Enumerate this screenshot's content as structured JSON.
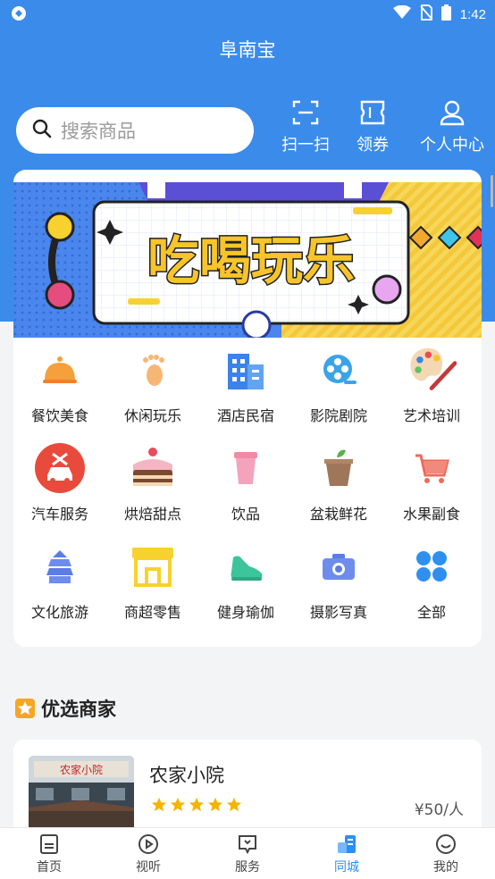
{
  "status_bar": {
    "time": "1:42"
  },
  "app": {
    "title": "阜南宝"
  },
  "search": {
    "placeholder": "搜索商品"
  },
  "quick_actions": [
    {
      "label": "扫一扫",
      "icon": "scan-icon"
    },
    {
      "label": "领券",
      "icon": "coupon-icon"
    },
    {
      "label": "个人中心",
      "icon": "user-icon"
    }
  ],
  "banner": {
    "text": "吃喝玩乐"
  },
  "categories": [
    {
      "label": "餐饮美食",
      "icon": "food-cover-icon"
    },
    {
      "label": "休闲玩乐",
      "icon": "footprint-icon"
    },
    {
      "label": "酒店民宿",
      "icon": "hotel-icon"
    },
    {
      "label": "影院剧院",
      "icon": "film-reel-icon"
    },
    {
      "label": "艺术培训",
      "icon": "palette-icon"
    },
    {
      "label": "汽车服务",
      "icon": "car-service-icon"
    },
    {
      "label": "烘焙甜点",
      "icon": "cake-icon"
    },
    {
      "label": "饮品",
      "icon": "drink-cup-icon"
    },
    {
      "label": "盆栽鲜花",
      "icon": "plant-pot-icon"
    },
    {
      "label": "水果副食",
      "icon": "shopping-cart-icon"
    },
    {
      "label": "文化旅游",
      "icon": "pagoda-icon"
    },
    {
      "label": "商超零售",
      "icon": "store-icon"
    },
    {
      "label": "健身瑜伽",
      "icon": "sneaker-icon"
    },
    {
      "label": "摄影写真",
      "icon": "camera-icon"
    },
    {
      "label": "全部",
      "icon": "grid-all-icon"
    }
  ],
  "featured": {
    "title": "优选商家",
    "merchants": [
      {
        "name": "农家小院",
        "price": "¥50/人",
        "rating": 5,
        "thumb_sign": "农家小院"
      }
    ]
  },
  "bottom_nav": [
    {
      "label": "首页",
      "icon": "home-doc-icon",
      "active": false
    },
    {
      "label": "视听",
      "icon": "play-icon",
      "active": false
    },
    {
      "label": "服务",
      "icon": "service-icon",
      "active": false
    },
    {
      "label": "同城",
      "icon": "city-icon",
      "active": true
    },
    {
      "label": "我的",
      "icon": "smile-icon",
      "active": false
    }
  ],
  "colors": {
    "primary": "#3b8bea",
    "active_nav": "#2f8fef",
    "star": "#f5b400"
  }
}
